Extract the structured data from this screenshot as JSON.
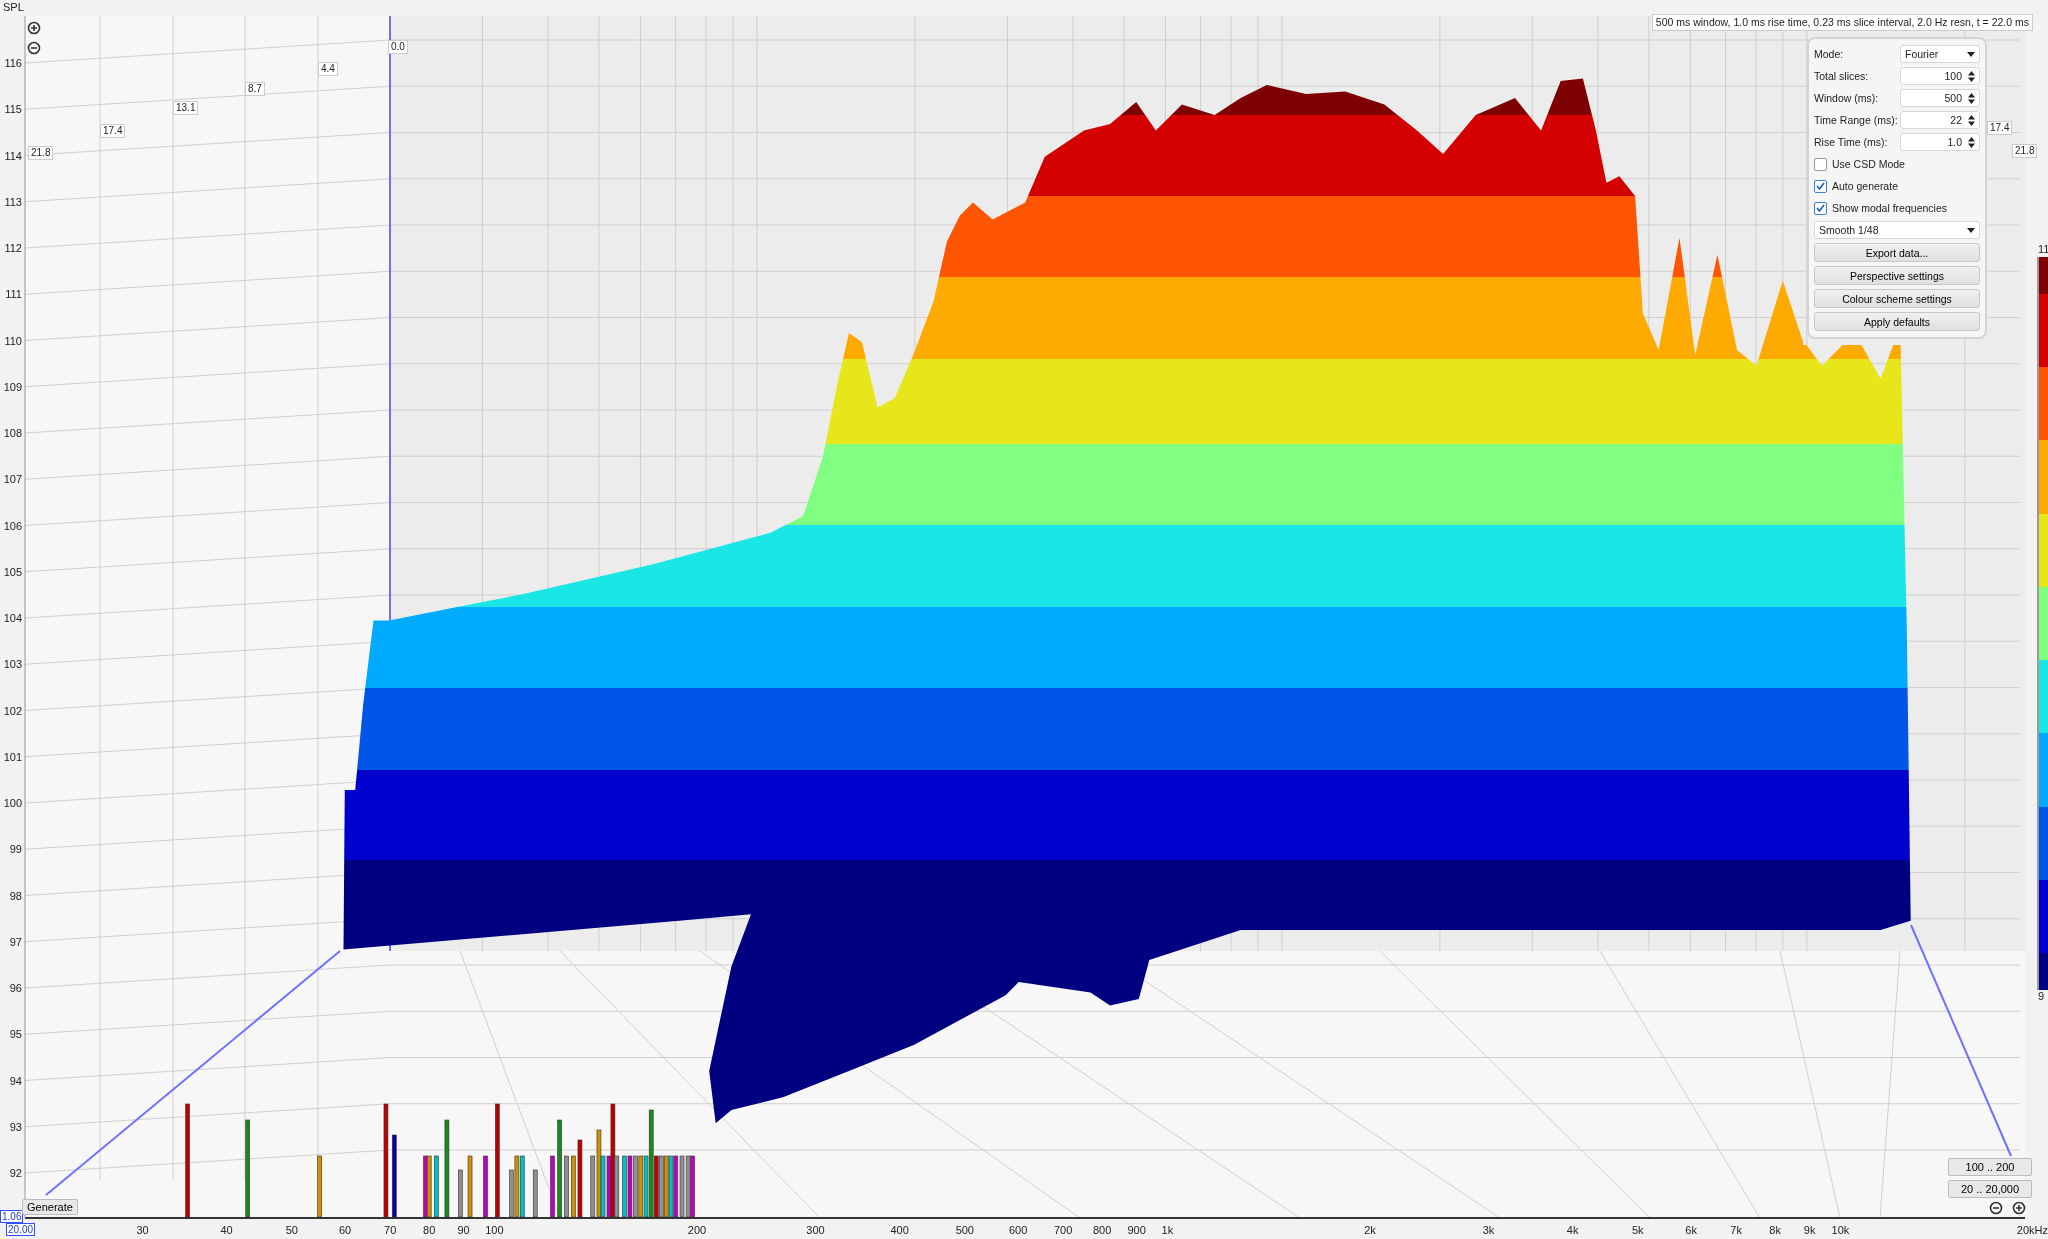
{
  "y_axis": {
    "title": "SPL",
    "ticks": [
      "116",
      "115",
      "114",
      "113",
      "112",
      "111",
      "110",
      "109",
      "108",
      "107",
      "106",
      "105",
      "104",
      "103",
      "102",
      "101",
      "100",
      "99",
      "98",
      "97",
      "96",
      "95",
      "94",
      "93",
      "92"
    ]
  },
  "time_axis": {
    "left_labels": [
      "21.8",
      "17.4",
      "13.1",
      "8.7",
      "4.4",
      "0.0"
    ],
    "right_labels": [
      "17.4",
      "21.8"
    ]
  },
  "x_axis": {
    "ticks": [
      "30",
      "40",
      "50",
      "60",
      "70",
      "80",
      "90",
      "100",
      "200",
      "300",
      "400",
      "500",
      "600",
      "700",
      "800",
      "900",
      "1k",
      "2k",
      "3k",
      "4k",
      "5k",
      "6k",
      "7k",
      "8k",
      "9k",
      "10k",
      "20kHz"
    ]
  },
  "info": "500 ms window, 1.0 ms rise time, 0.23 ms slice interval, 2.0 Hz resn, t = 22.0 ms",
  "cursor": {
    "level": "1.06",
    "frequency": "20.00"
  },
  "generate_button": "Generate",
  "range_buttons": [
    "100 .. 200",
    "20 .. 20,000"
  ],
  "panel": {
    "mode": {
      "label": "Mode:",
      "value": "Fourier"
    },
    "fields": [
      {
        "label": "Total slices:",
        "value": "100"
      },
      {
        "label": "Window (ms):",
        "value": "500"
      },
      {
        "label": "Time Range (ms):",
        "value": "22"
      },
      {
        "label": "Rise Time (ms):",
        "value": "1.0"
      }
    ],
    "options": [
      {
        "label": "Use CSD Mode",
        "checked": false
      },
      {
        "label": "Auto generate",
        "checked": true
      },
      {
        "label": "Show modal frequencies",
        "checked": true
      }
    ],
    "smoothing": "Smooth 1/48",
    "buttons": [
      "Export data...",
      "Perspective settings",
      "Colour scheme settings",
      "Apply defaults"
    ]
  },
  "colour_scale": {
    "top_label": "11",
    "bottom_label": "9",
    "bands": [
      {
        "color": "#7f0000"
      },
      {
        "color": "#d40000"
      },
      {
        "color": "#ff5500"
      },
      {
        "color": "#ffaa00"
      },
      {
        "color": "#e6e61a"
      },
      {
        "color": "#80ff80"
      },
      {
        "color": "#1ae6e6"
      },
      {
        "color": "#00aaff"
      },
      {
        "color": "#0055e6"
      },
      {
        "color": "#0000cc"
      },
      {
        "color": "#000080"
      }
    ]
  }
}
